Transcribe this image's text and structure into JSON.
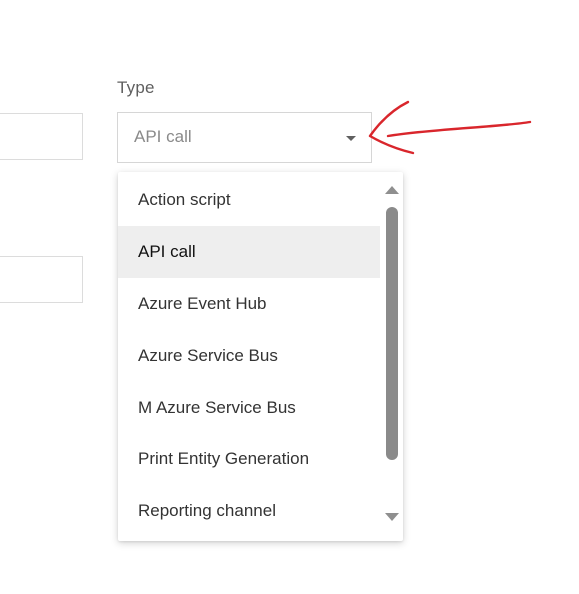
{
  "form": {
    "type_field": {
      "label": "Type",
      "value": "API call"
    }
  },
  "dropdown": {
    "options": [
      {
        "label": "Action script",
        "selected": false
      },
      {
        "label": "API call",
        "selected": true
      },
      {
        "label": "Azure Event Hub",
        "selected": false
      },
      {
        "label": "Azure Service Bus",
        "selected": false
      },
      {
        "label": "M Azure Service Bus",
        "selected": false
      },
      {
        "label": "Print Entity Generation",
        "selected": false
      },
      {
        "label": "Reporting channel",
        "selected": false
      }
    ]
  },
  "icons": {
    "select_caret": "caret-down-icon",
    "scroll_up": "scroll-up-icon",
    "scroll_down": "scroll-down-icon"
  },
  "colors": {
    "annotation_arrow": "#d9262c",
    "selected_option_bg": "#eeeeee",
    "scrollbar": "#8a8a8a"
  }
}
